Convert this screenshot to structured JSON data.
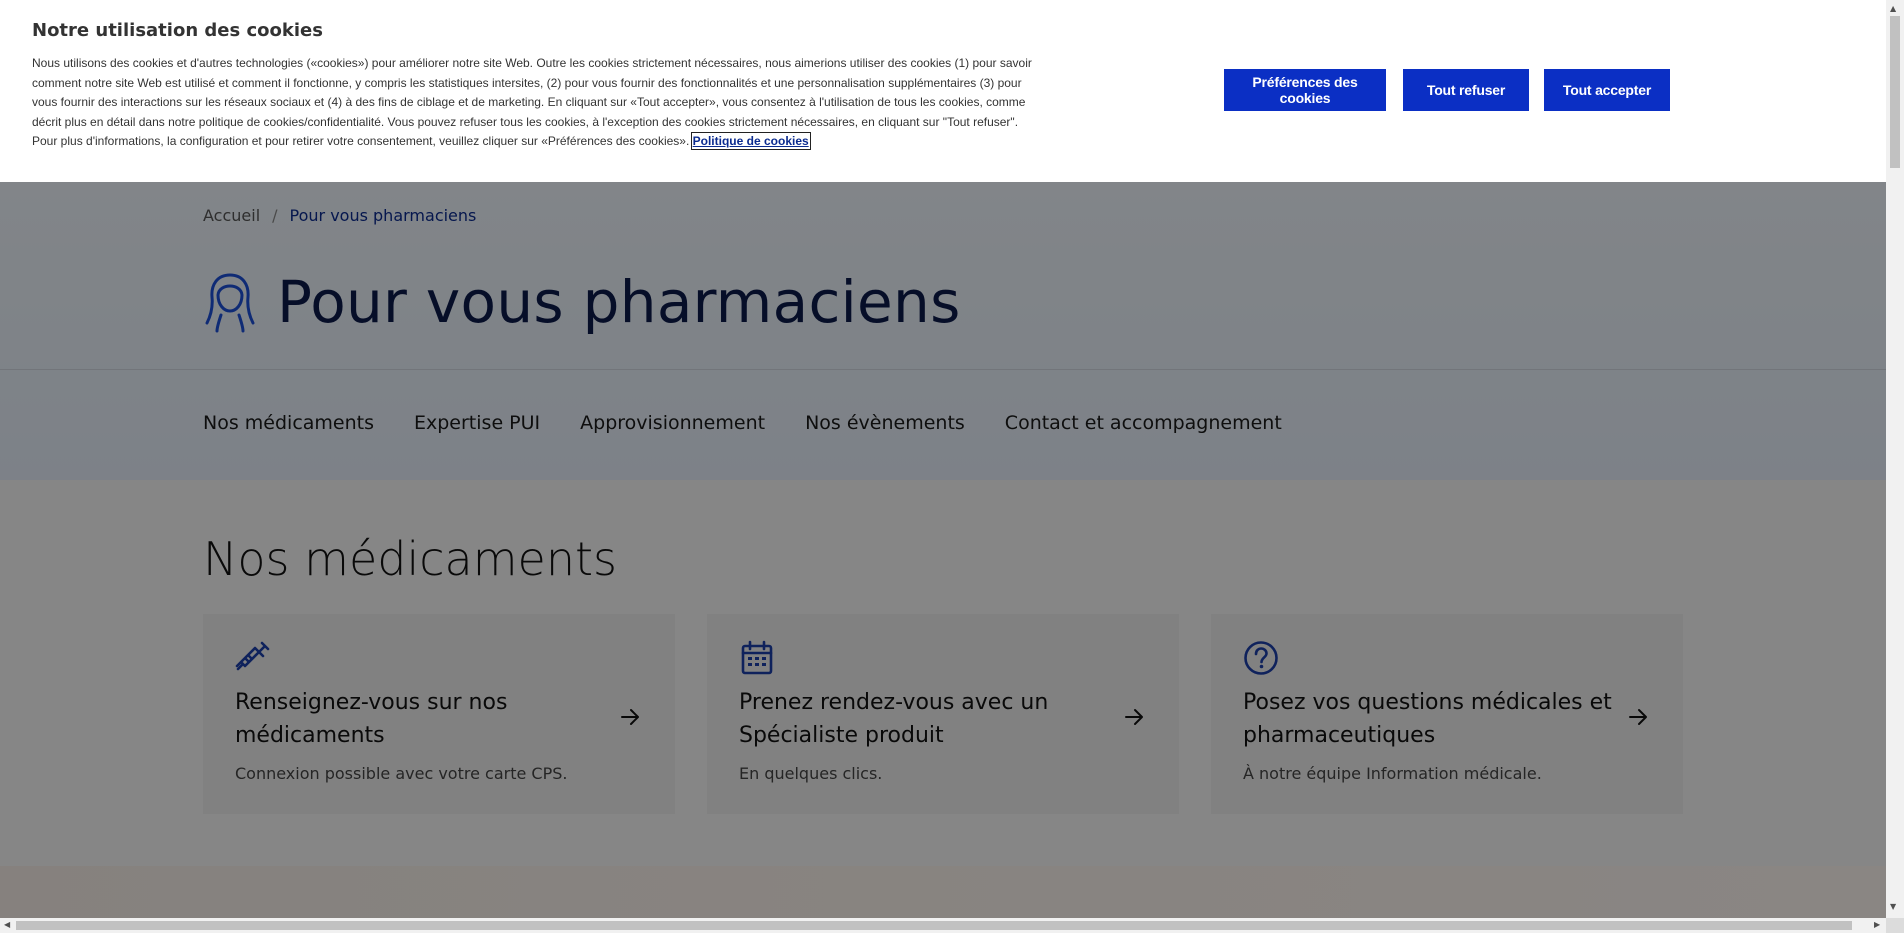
{
  "cookie_banner": {
    "title": "Notre utilisation des cookies",
    "text": "Nous utilisons des cookies et d'autres technologies («cookies») pour améliorer notre site Web. Outre les cookies strictement nécessaires, nous aimerions utiliser des cookies (1) pour savoir comment notre site Web est utilisé et comment il fonctionne, y compris les statistiques intersites, (2) pour vous fournir des fonctionnalités et une personnalisation supplémentaires (3) pour vous fournir des interactions sur les réseaux sociaux et (4) à des fins de ciblage et de marketing. En cliquant sur «Tout accepter», vous consentez à l'utilisation de tous les cookies, comme décrit plus en détail dans notre politique de cookies/confidentialité. Vous pouvez refuser tous les cookies, à l'exception des cookies strictement nécessaires, en cliquant sur \"Tout refuser\". Pour plus d'informations, la configuration et pour retirer votre consentement, veuillez cliquer sur «Préférences des cookies».",
    "policy_link": "Politique de cookies",
    "buttons": {
      "preferences": "Préférences des cookies",
      "refuse_all": "Tout refuser",
      "accept_all": "Tout accepter"
    },
    "button_color": "#0b2fc4"
  },
  "breadcrumb": {
    "home": "Accueil",
    "separator": "/",
    "current": "Pour vous pharmaciens"
  },
  "page_title": "Pour vous pharmaciens",
  "title_icon": "pharmacist-person-icon",
  "subnav": {
    "items": [
      "Nos médicaments",
      "Expertise PUI",
      "Approvisionnement",
      "Nos évènements",
      "Contact et accompagnement"
    ]
  },
  "section": {
    "title": "Nos médicaments",
    "cards": [
      {
        "icon": "syringe-icon",
        "title": "Renseignez-vous sur nos médicaments",
        "description": "Connexion possible avec votre carte CPS."
      },
      {
        "icon": "calendar-icon",
        "title": "Prenez rendez-vous avec un Spécialiste produit",
        "description": "En quelques clics."
      },
      {
        "icon": "question-icon",
        "title": "Posez vos questions médicales et pharmaceutiques",
        "description": "À notre équipe Information médicale."
      }
    ]
  },
  "colors": {
    "brand_blue": "#0b2b8f",
    "title_navy": "#0b1a4a"
  }
}
